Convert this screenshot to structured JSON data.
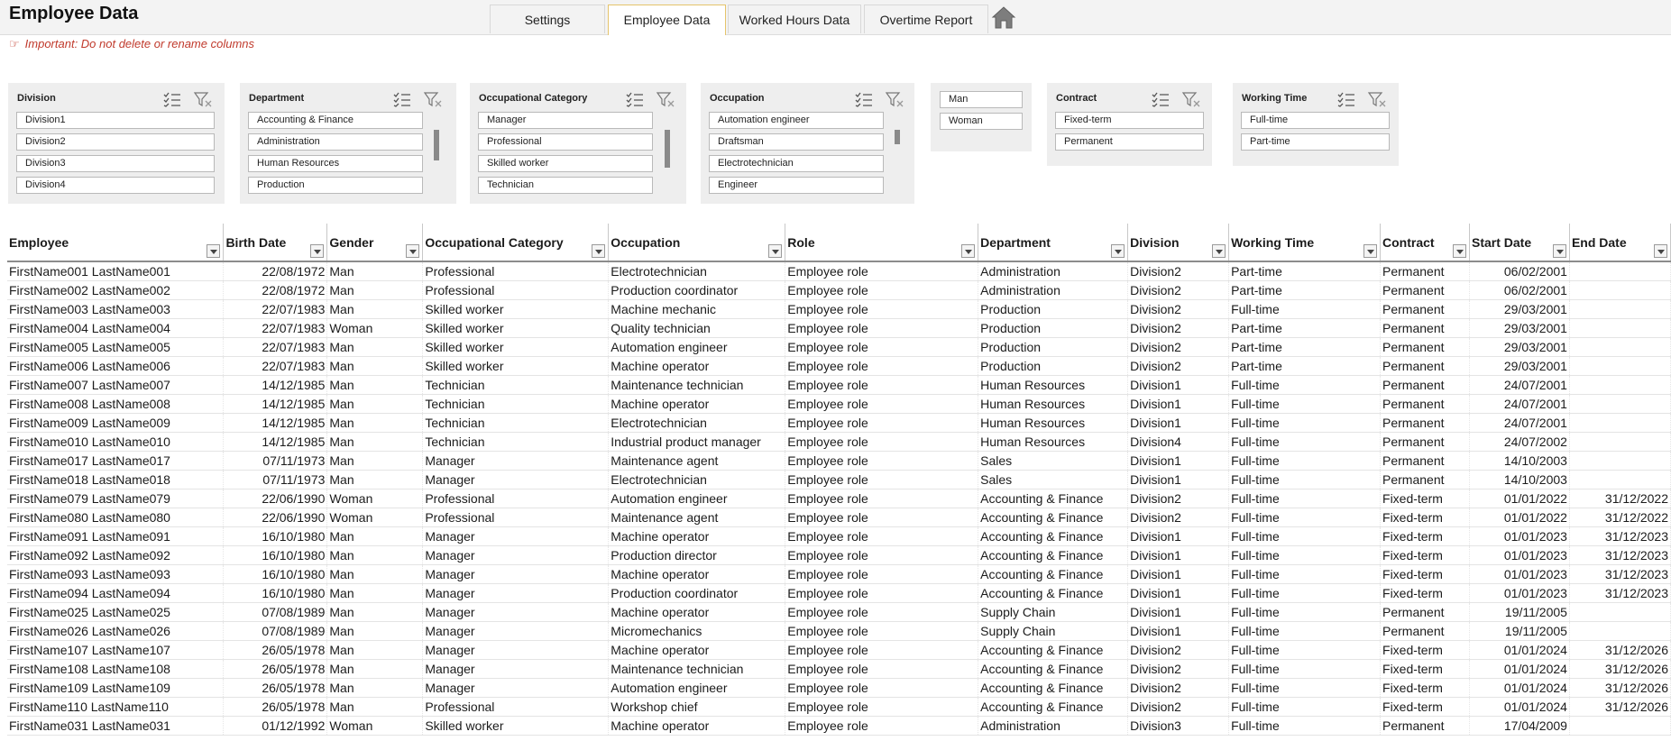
{
  "app": {
    "title": "Employee Data"
  },
  "tabs": [
    {
      "label": "Settings",
      "active": false
    },
    {
      "label": "Employee Data",
      "active": true
    },
    {
      "label": "Worked Hours Data",
      "active": false
    },
    {
      "label": "Overtime Report",
      "active": false
    }
  ],
  "warning": {
    "text": "Important: Do not delete or rename columns",
    "icon": "hand-pointing-icon"
  },
  "colors": {
    "warning": "#c0392b",
    "active_tab_border": "#e5c46b",
    "slicer_bg": "#eeeeee"
  },
  "slicers": {
    "division": {
      "title": "Division",
      "items": [
        "Division1",
        "Division2",
        "Division3",
        "Division4"
      ]
    },
    "department": {
      "title": "Department",
      "items": [
        "Accounting & Finance",
        "Administration",
        "Human Resources",
        "Production"
      ]
    },
    "occupational_category": {
      "title": "Occupational Category",
      "items": [
        "Manager",
        "Professional",
        "Skilled worker",
        "Technician"
      ]
    },
    "occupation": {
      "title": "Occupation",
      "items": [
        "Automation engineer",
        "Draftsman",
        "Electrotechnician",
        "Engineer"
      ]
    },
    "gender": {
      "items": [
        "Man",
        "Woman"
      ]
    },
    "contract": {
      "title": "Contract",
      "items": [
        "Fixed-term",
        "Permanent"
      ]
    },
    "working_time": {
      "title": "Working Time",
      "items": [
        "Full-time",
        "Part-time"
      ]
    }
  },
  "table": {
    "columns": [
      "Employee",
      "Birth Date",
      "Gender",
      "Occupational Category",
      "Occupation",
      "Role",
      "Department",
      "Division",
      "Working Time",
      "Contract",
      "Start Date",
      "End Date"
    ],
    "rows": [
      [
        "FirstName001  LastName001",
        "22/08/1972",
        "Man",
        "Professional",
        "Electrotechnician",
        "Employee role",
        "Administration",
        "Division2",
        "Part-time",
        "Permanent",
        "06/02/2001",
        ""
      ],
      [
        "FirstName002  LastName002",
        "22/08/1972",
        "Man",
        "Professional",
        "Production coordinator",
        "Employee role",
        "Administration",
        "Division2",
        "Part-time",
        "Permanent",
        "06/02/2001",
        ""
      ],
      [
        "FirstName003  LastName003",
        "22/07/1983",
        "Man",
        "Skilled worker",
        "Machine mechanic",
        "Employee role",
        "Production",
        "Division2",
        "Full-time",
        "Permanent",
        "29/03/2001",
        ""
      ],
      [
        "FirstName004  LastName004",
        "22/07/1983",
        "Woman",
        "Skilled worker",
        "Quality technician",
        "Employee role",
        "Production",
        "Division2",
        "Part-time",
        "Permanent",
        "29/03/2001",
        ""
      ],
      [
        "FirstName005  LastName005",
        "22/07/1983",
        "Man",
        "Skilled worker",
        "Automation engineer",
        "Employee role",
        "Production",
        "Division2",
        "Part-time",
        "Permanent",
        "29/03/2001",
        ""
      ],
      [
        "FirstName006  LastName006",
        "22/07/1983",
        "Man",
        "Skilled worker",
        "Machine operator",
        "Employee role",
        "Production",
        "Division2",
        "Part-time",
        "Permanent",
        "29/03/2001",
        ""
      ],
      [
        "FirstName007  LastName007",
        "14/12/1985",
        "Man",
        "Technician",
        "Maintenance technician",
        "Employee role",
        "Human Resources",
        "Division1",
        "Full-time",
        "Permanent",
        "24/07/2001",
        ""
      ],
      [
        "FirstName008  LastName008",
        "14/12/1985",
        "Man",
        "Technician",
        "Machine operator",
        "Employee role",
        "Human Resources",
        "Division1",
        "Full-time",
        "Permanent",
        "24/07/2001",
        ""
      ],
      [
        "FirstName009  LastName009",
        "14/12/1985",
        "Man",
        "Technician",
        "Electrotechnician",
        "Employee role",
        "Human Resources",
        "Division1",
        "Full-time",
        "Permanent",
        "24/07/2001",
        ""
      ],
      [
        "FirstName010  LastName010",
        "14/12/1985",
        "Man",
        "Technician",
        "Industrial product manager",
        "Employee role",
        "Human Resources",
        "Division4",
        "Full-time",
        "Permanent",
        "24/07/2002",
        ""
      ],
      [
        "FirstName017  LastName017",
        "07/11/1973",
        "Man",
        "Manager",
        "Maintenance agent",
        "Employee role",
        "Sales",
        "Division1",
        "Full-time",
        "Permanent",
        "14/10/2003",
        ""
      ],
      [
        "FirstName018  LastName018",
        "07/11/1973",
        "Man",
        "Manager",
        "Electrotechnician",
        "Employee role",
        "Sales",
        "Division1",
        "Full-time",
        "Permanent",
        "14/10/2003",
        ""
      ],
      [
        "FirstName079  LastName079",
        "22/06/1990",
        "Woman",
        "Professional",
        "Automation engineer",
        "Employee role",
        "Accounting & Finance",
        "Division2",
        "Full-time",
        "Fixed-term",
        "01/01/2022",
        "31/12/2022"
      ],
      [
        "FirstName080  LastName080",
        "22/06/1990",
        "Woman",
        "Professional",
        "Maintenance agent",
        "Employee role",
        "Accounting & Finance",
        "Division2",
        "Full-time",
        "Fixed-term",
        "01/01/2022",
        "31/12/2022"
      ],
      [
        "FirstName091  LastName091",
        "16/10/1980",
        "Man",
        "Manager",
        "Machine operator",
        "Employee role",
        "Accounting & Finance",
        "Division1",
        "Full-time",
        "Fixed-term",
        "01/01/2023",
        "31/12/2023"
      ],
      [
        "FirstName092  LastName092",
        "16/10/1980",
        "Man",
        "Manager",
        "Production director",
        "Employee role",
        "Accounting & Finance",
        "Division1",
        "Full-time",
        "Fixed-term",
        "01/01/2023",
        "31/12/2023"
      ],
      [
        "FirstName093  LastName093",
        "16/10/1980",
        "Man",
        "Manager",
        "Machine operator",
        "Employee role",
        "Accounting & Finance",
        "Division1",
        "Full-time",
        "Fixed-term",
        "01/01/2023",
        "31/12/2023"
      ],
      [
        "FirstName094  LastName094",
        "16/10/1980",
        "Man",
        "Manager",
        "Production coordinator",
        "Employee role",
        "Accounting & Finance",
        "Division1",
        "Full-time",
        "Fixed-term",
        "01/01/2023",
        "31/12/2023"
      ],
      [
        "FirstName025  LastName025",
        "07/08/1989",
        "Man",
        "Manager",
        "Machine operator",
        "Employee role",
        "Supply Chain",
        "Division1",
        "Full-time",
        "Permanent",
        "19/11/2005",
        ""
      ],
      [
        "FirstName026  LastName026",
        "07/08/1989",
        "Man",
        "Manager",
        "Micromechanics",
        "Employee role",
        "Supply Chain",
        "Division1",
        "Full-time",
        "Permanent",
        "19/11/2005",
        ""
      ],
      [
        "FirstName107  LastName107",
        "26/05/1978",
        "Man",
        "Manager",
        "Machine operator",
        "Employee role",
        "Accounting & Finance",
        "Division2",
        "Full-time",
        "Fixed-term",
        "01/01/2024",
        "31/12/2026"
      ],
      [
        "FirstName108  LastName108",
        "26/05/1978",
        "Man",
        "Manager",
        "Maintenance technician",
        "Employee role",
        "Accounting & Finance",
        "Division2",
        "Full-time",
        "Fixed-term",
        "01/01/2024",
        "31/12/2026"
      ],
      [
        "FirstName109  LastName109",
        "26/05/1978",
        "Man",
        "Manager",
        "Automation engineer",
        "Employee role",
        "Accounting & Finance",
        "Division2",
        "Full-time",
        "Fixed-term",
        "01/01/2024",
        "31/12/2026"
      ],
      [
        "FirstName110  LastName110",
        "26/05/1978",
        "Man",
        "Professional",
        "Workshop chief",
        "Employee role",
        "Accounting & Finance",
        "Division2",
        "Full-time",
        "Fixed-term",
        "01/01/2024",
        "31/12/2026"
      ],
      [
        "FirstName031  LastName031",
        "01/12/1992",
        "Woman",
        "Skilled worker",
        "Machine operator",
        "Employee role",
        "Administration",
        "Division3",
        "Full-time",
        "Permanent",
        "17/04/2009",
        ""
      ]
    ]
  }
}
